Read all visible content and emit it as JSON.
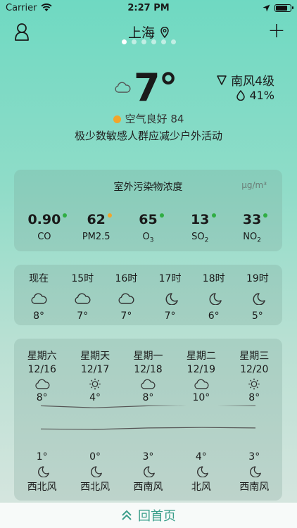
{
  "status": {
    "carrier": "Carrier",
    "time": "2:27 PM",
    "battery_level": 0.85
  },
  "nav": {
    "city": "上海",
    "page_count": 6,
    "active_page": 0
  },
  "current": {
    "temp": "7°",
    "icon": "cloud-icon",
    "wind": "南风4级",
    "humidity": "41%",
    "aqi_text": "空气良好 84",
    "advice": "极少数敏感人群应减少户外活动",
    "aqi_color": "#f1a52b"
  },
  "pollution": {
    "title": "室外污染物浓度",
    "unit": "μg/m³",
    "items": [
      {
        "value": "0.90",
        "name": "CO",
        "sub": "",
        "color": "#2fae43"
      },
      {
        "value": "62",
        "name": "PM2.5",
        "sub": "",
        "color": "#f1a52b"
      },
      {
        "value": "65",
        "name": "O",
        "sub": "3",
        "color": "#2fae43"
      },
      {
        "value": "13",
        "name": "SO",
        "sub": "2",
        "color": "#2fae43"
      },
      {
        "value": "33",
        "name": "NO",
        "sub": "2",
        "color": "#2fae43"
      }
    ]
  },
  "hourly": [
    {
      "time": "现在",
      "icon": "cloud-icon",
      "temp": "8°"
    },
    {
      "time": "15时",
      "icon": "cloud-icon",
      "temp": "7°"
    },
    {
      "time": "16时",
      "icon": "cloud-icon",
      "temp": "7°"
    },
    {
      "time": "17时",
      "icon": "moon-icon",
      "temp": "7°"
    },
    {
      "time": "18时",
      "icon": "moon-icon",
      "temp": "6°"
    },
    {
      "time": "19时",
      "icon": "moon-icon",
      "temp": "5°"
    }
  ],
  "daily": [
    {
      "day": "星期六",
      "date": "12/16",
      "day_icon": "cloud-icon",
      "high": "8°",
      "low": "1°",
      "night_icon": "moon-icon",
      "wind": "西北风",
      "high_val": 8,
      "low_val": 1
    },
    {
      "day": "星期天",
      "date": "12/17",
      "day_icon": "sun-icon",
      "high": "4°",
      "low": "0°",
      "night_icon": "moon-icon",
      "wind": "西北风",
      "high_val": 4,
      "low_val": 0
    },
    {
      "day": "星期一",
      "date": "12/18",
      "day_icon": "cloud-icon",
      "high": "8°",
      "low": "3°",
      "night_icon": "moon-icon",
      "wind": "西南风",
      "high_val": 8,
      "low_val": 3
    },
    {
      "day": "星期二",
      "date": "12/19",
      "day_icon": "cloud-icon",
      "high": "10°",
      "low": "4°",
      "night_icon": "moon-icon",
      "wind": "北风",
      "high_val": 10,
      "low_val": 4
    },
    {
      "day": "星期三",
      "date": "12/20",
      "day_icon": "sun-icon",
      "high": "8°",
      "low": "3°",
      "night_icon": "moon-icon",
      "wind": "西南风",
      "high_val": 8,
      "low_val": 3
    }
  ],
  "bottom": {
    "label": "回首页"
  }
}
